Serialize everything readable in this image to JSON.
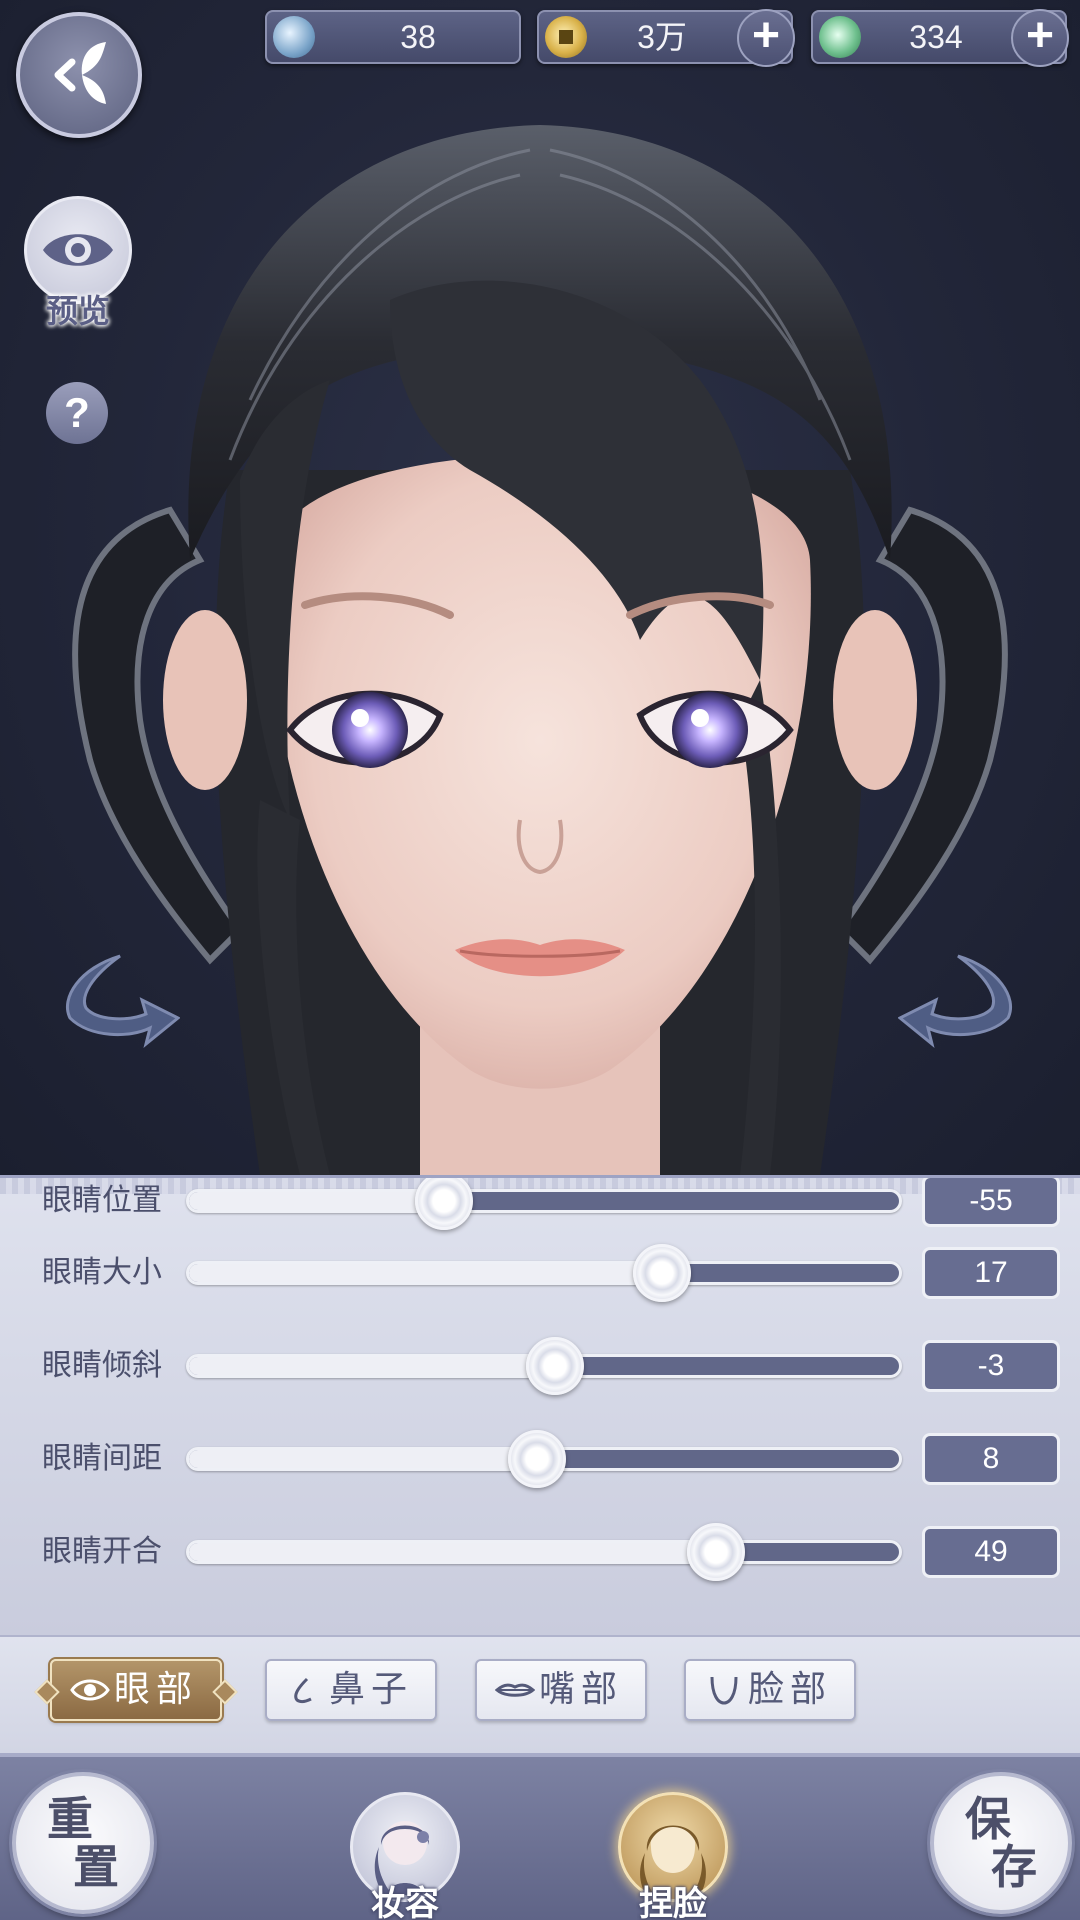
{
  "currencies": [
    {
      "name": "jade",
      "value": "38",
      "has_plus": false,
      "color": "#8fb6d8"
    },
    {
      "name": "coin",
      "value": "3万",
      "has_plus": true,
      "color": "#d9b24a"
    },
    {
      "name": "token",
      "value": "334",
      "has_plus": true,
      "color": "#6fc08e"
    }
  ],
  "plus_glyph": "+",
  "left_controls": {
    "back_icon": "butterfly-back-icon",
    "preview_label": "预览",
    "preview_icon": "eye-icon",
    "help_label": "?"
  },
  "sliders": [
    {
      "label": "眼睛位置",
      "value": -55,
      "position": 0.36
    },
    {
      "label": "眼睛大小",
      "value": 17,
      "position": 0.665
    },
    {
      "label": "眼睛倾斜",
      "value": -3,
      "position": 0.515
    },
    {
      "label": "眼睛间距",
      "value": 8,
      "position": 0.49
    },
    {
      "label": "眼睛开合",
      "value": 49,
      "position": 0.74
    }
  ],
  "tabs": [
    {
      "label": "眼部",
      "icon": "eye-icon",
      "active": true
    },
    {
      "label": "鼻子",
      "icon": "nose-icon",
      "active": false
    },
    {
      "label": "嘴部",
      "icon": "lips-icon",
      "active": false
    },
    {
      "label": "脸部",
      "icon": "chin-icon",
      "active": false
    }
  ],
  "bottom": {
    "reset": [
      "重",
      "置"
    ],
    "save": [
      "保",
      "存"
    ],
    "makeup_label": "妆容",
    "face_label": "捏脸"
  },
  "colors": {
    "accent_gold": "#a9895d",
    "panel_bg": "#d9dcea",
    "track_dark": "#616789"
  }
}
